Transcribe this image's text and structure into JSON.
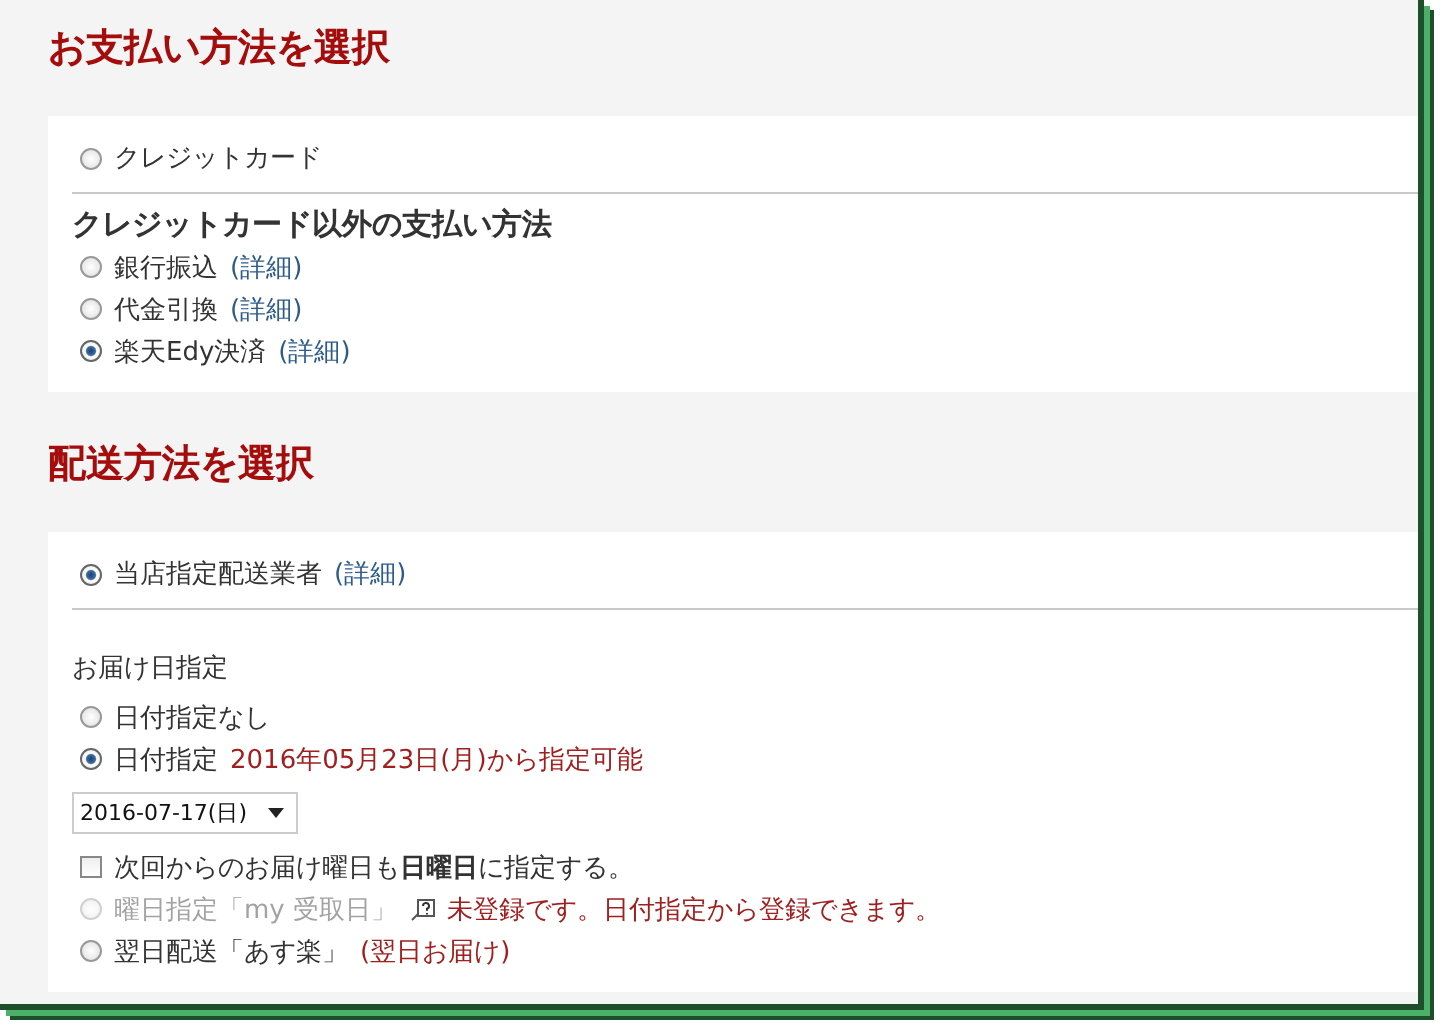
{
  "payment": {
    "title": "お支払い方法を選択",
    "primary_options": [
      {
        "label": "クレジットカード",
        "selected": false
      }
    ],
    "other_heading": "クレジットカード以外の支払い方法",
    "other_options": [
      {
        "label": "銀行振込",
        "link": "(詳細)",
        "selected": false
      },
      {
        "label": "代金引換",
        "link": "(詳細)",
        "selected": false
      },
      {
        "label": "楽天Edy決済",
        "link": "(詳細)",
        "selected": true
      }
    ]
  },
  "shipping": {
    "title": "配送方法を選択",
    "carriers": [
      {
        "label": "当店指定配送業者",
        "link": "(詳細)",
        "selected": true
      }
    ],
    "date_heading": "お届け日指定",
    "date_options": [
      {
        "label": "日付指定なし",
        "selected": false
      },
      {
        "label": "日付指定",
        "note": "2016年05月23日(月)から指定可能",
        "selected": true
      }
    ],
    "date_select": {
      "value": "2016-07-17(日)"
    },
    "remember": {
      "label": "次回からのお届け曜日も**日曜日**に指定する。",
      "checked": false
    },
    "extra_options": [
      {
        "label": "曜日指定「my 受取日」",
        "help": true,
        "note": "未登録です。日付指定から登録できます。",
        "selected": false,
        "disabled": true
      },
      {
        "label": "翌日配送「あす楽」",
        "note": "(翌日お届け)",
        "selected": false,
        "disabled": false
      }
    ]
  }
}
